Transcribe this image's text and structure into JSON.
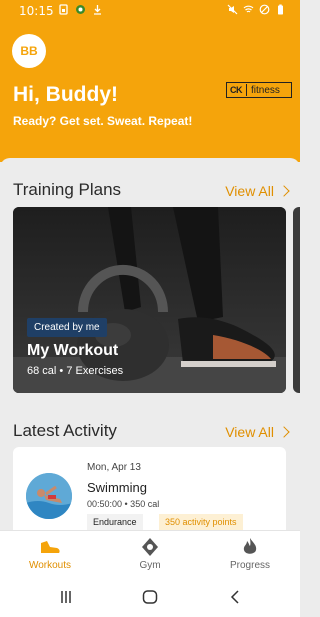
{
  "status_bar": {
    "time": "10:15"
  },
  "header": {
    "avatar_initials": "BB",
    "greeting": "Hi, Buddy!",
    "tagline": "Ready? Get set. Sweat. Repeat!",
    "brand": {
      "mark": "CK",
      "name": "fitness"
    }
  },
  "training_plans": {
    "title": "Training Plans",
    "view_all": "View All",
    "card": {
      "badge": "Created by me",
      "name": "My Workout",
      "meta": "68 cal • 7 Exercises"
    }
  },
  "latest_activity": {
    "title": "Latest Activity",
    "view_all": "View All",
    "item": {
      "date": "Mon, Apr 13",
      "name": "Swimming",
      "meta": "00:50:00 • 350 cal",
      "tag": "Endurance",
      "points": "350 activity points"
    }
  },
  "bottom_nav": {
    "items": [
      {
        "label": "Workouts",
        "icon": "shoe-icon",
        "active": true
      },
      {
        "label": "Gym",
        "icon": "location-pin-icon",
        "active": false
      },
      {
        "label": "Progress",
        "icon": "flame-icon",
        "active": false
      }
    ]
  },
  "colors": {
    "accent": "#f5a40b",
    "accent_text": "#e08f00",
    "badge": "#1f3f66"
  }
}
